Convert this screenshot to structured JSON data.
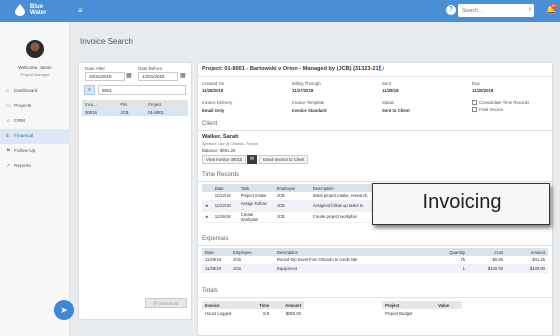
{
  "brand": {
    "line1": "Blue",
    "line2": "Water"
  },
  "topbar": {
    "search_placeholder": "Search..."
  },
  "notifications": {
    "badge": "9+"
  },
  "user": {
    "welcome": "Welcome, Jason",
    "role": "Project Manager"
  },
  "sidebar": {
    "items": [
      {
        "label": "Dashboard",
        "icon": "home-icon"
      },
      {
        "label": "Projects",
        "icon": "folder-icon"
      },
      {
        "label": "CRM",
        "icon": "people-icon"
      },
      {
        "label": "Financial",
        "icon": "dollar-icon",
        "active": true
      },
      {
        "label": "Follow Up",
        "icon": "flag-icon"
      },
      {
        "label": "Reports",
        "icon": "chart-icon"
      }
    ]
  },
  "page": {
    "title": "Invoice Search"
  },
  "search": {
    "date_after_label": "Date After",
    "date_before_label": "Date Before",
    "date_after": "10/31/2018",
    "date_before": "12/01/2018",
    "query": "8001",
    "columns": [
      "Invo...",
      "PM",
      "Project"
    ],
    "rows": [
      [
        "30015",
        "JCB",
        "01-8001"
      ]
    ],
    "download_label": "Download"
  },
  "invoice": {
    "project_title": "Project: 01-8001 - Bartowski v Orion - Managed by (JCB) (31323-21)",
    "fields": {
      "created_on_label": "Created On",
      "created_on": "11/28/2018",
      "billing_through_label": "Billing Through",
      "billing_through": "11/27/2018",
      "sent_label": "Sent",
      "sent": "11/28/18",
      "due_label": "Due",
      "due": "11/28/2018",
      "delivery_label": "Invoice Delivery",
      "delivery": "Email Only",
      "template_label": "Invoice Template",
      "template": "Invoice Standard",
      "status_label": "Status",
      "status": "Sent to Client",
      "consolidate_label": "Consolidate Time Records",
      "final_label": "Final Invoice"
    },
    "client_section": "Client",
    "client_name": "Walker, Sarah",
    "client_sub": "Aperture Law @ Orlando, Florida",
    "client_balance": "Balance: $991.25",
    "view_invoice_button": "View Invoice 30015",
    "email_client_button": "Email Invoice to Client",
    "time_section": "Time Records",
    "time_columns": [
      "Date",
      "Task",
      "Employee",
      "Description"
    ],
    "time_rows": [
      {
        "star": "",
        "date": "11/22/18",
        "task": "Project Intake",
        "employee": "JCB",
        "desc": "Initial project intake, research,"
      },
      {
        "star": "★",
        "date": "11/22/18",
        "task": "Assign Follow ...",
        "employee": "JCB",
        "desc": "Assigned follow up tasks to"
      },
      {
        "star": "★",
        "date": "11/26/18",
        "task": "Create Workplan",
        "employee": "JCB",
        "desc": "Create project workplan"
      }
    ],
    "overlay_label": "Invoicing",
    "expenses_section": "Expenses",
    "expense_columns": [
      "Date",
      "Employee",
      "Description",
      "Quantity",
      "Cost",
      "Amount"
    ],
    "expense_rows": [
      {
        "date": "11/26/18",
        "employee": "JCB",
        "desc": "Round-trip travel from Orlando to credit site",
        "qty": "75",
        "cost": "$0.55",
        "amount": "$41.25"
      },
      {
        "date": "11/26/18",
        "employee": "JCB",
        "desc": "Equipment",
        "qty": "1",
        "cost": "$100.00",
        "amount": "$100.00"
      }
    ],
    "totals_section": "Totals",
    "totals_left_columns": [
      "Invoice",
      "Time",
      "Amount"
    ],
    "totals_left_row": [
      "Hours Logged",
      "8.5",
      "$850.00"
    ],
    "totals_right_columns": [
      "Project",
      "Value"
    ],
    "totals_right_row": [
      "Project Budget",
      ""
    ]
  }
}
